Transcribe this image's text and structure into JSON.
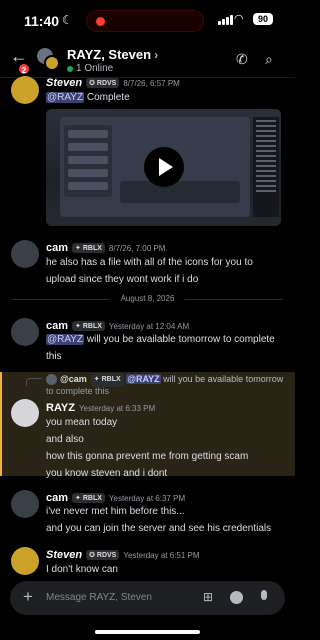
{
  "status_bar": {
    "time": "11:40",
    "battery": "90"
  },
  "header": {
    "unread_badge": "2",
    "title": "RAYZ, Steven",
    "status": "1 Online"
  },
  "messages": [
    {
      "author": "Steven",
      "tag": "RDVS",
      "timestamp": "8/7/26, 6:57 PM",
      "mention": "@RAYZ",
      "text": " Complete"
    },
    {
      "author": "cam",
      "tag": "RBLX",
      "timestamp": "8/7/26, 7:00 PM",
      "line1": "he also has a file with all of the icons for you to",
      "line2": "upload since they wont work if i do"
    },
    {
      "author": "cam",
      "tag": "RBLX",
      "timestamp": "Yesterday at 12:04 AM",
      "mention": "@RAYZ",
      "text": " will you be available tomorrow to complete",
      "line2": "this"
    },
    {
      "reply_author": "@cam",
      "reply_tag": "RBLX",
      "reply_mention": "@RAYZ",
      "reply_text": " will you be available tomorrow",
      "reply_cont": "to complete this",
      "author": "RAYZ",
      "timestamp": "Yesterday at 6:33 PM",
      "lines": [
        "you mean today",
        "and also",
        "how this gonna prevent me from getting scam",
        "you know steven and i dont"
      ]
    },
    {
      "author": "cam",
      "tag": "RBLX",
      "timestamp": "Yesterday at 6:37 PM",
      "lines": [
        "i've never met him before this...",
        "and you can join the server and see his credentials"
      ]
    },
    {
      "author": "Steven",
      "tag": "RDVS",
      "timestamp": "Yesterday at 6:51 PM",
      "lines": [
        "I don't know can"
      ]
    }
  ],
  "date_divider": "August 8, 2026",
  "composer": {
    "placeholder": "Message RAYZ, Steven"
  },
  "icons": [
    "back-chevron-icon",
    "call-icon",
    "search-icon",
    "play-icon",
    "plus-icon",
    "gift-icon",
    "emoji-icon",
    "microphone-icon"
  ]
}
